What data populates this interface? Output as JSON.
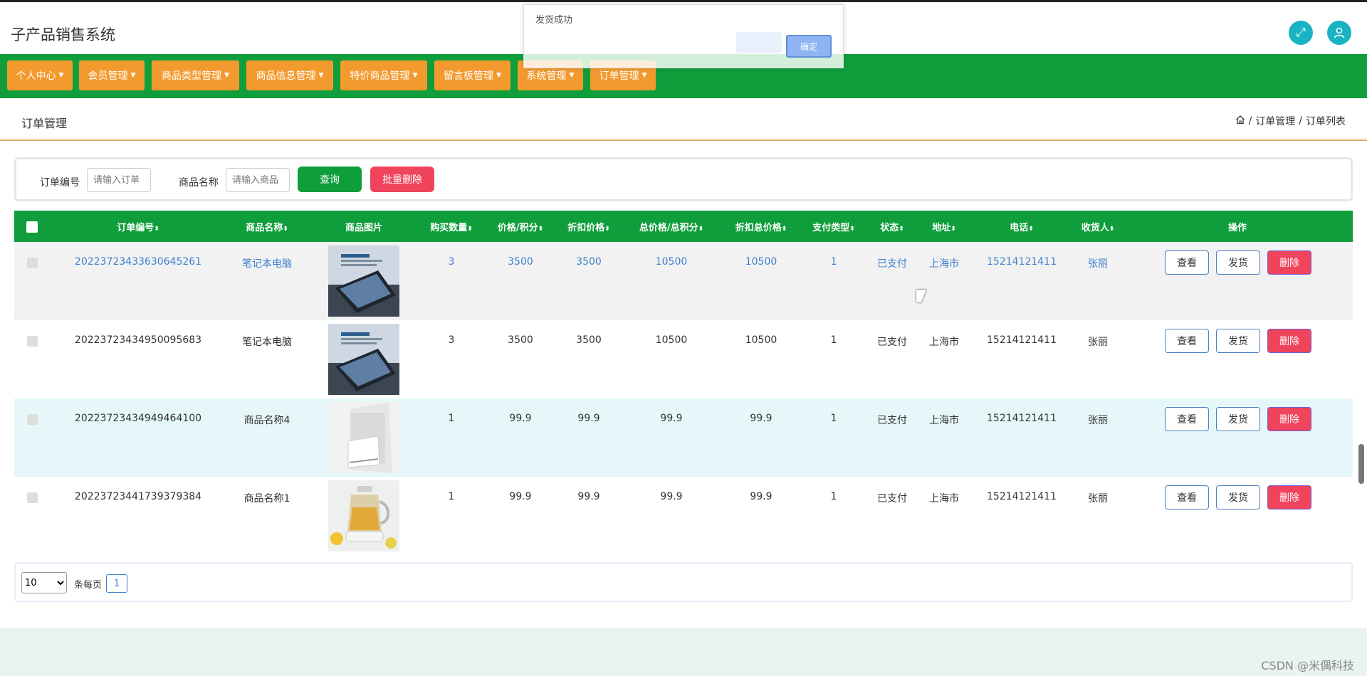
{
  "app": {
    "title": "子产品销售系统"
  },
  "header_icons": [
    "fullscreen-icon",
    "user-icon"
  ],
  "nav": {
    "items": [
      {
        "label": "个人中心"
      },
      {
        "label": "会员管理"
      },
      {
        "label": "商品类型管理"
      },
      {
        "label": "商品信息管理"
      },
      {
        "label": "特价商品管理"
      },
      {
        "label": "留言板管理"
      },
      {
        "label": "系统管理"
      },
      {
        "label": "订单管理"
      }
    ]
  },
  "breadcrumb": {
    "page_title": "订单管理",
    "trail": [
      "订单管理",
      "订单列表"
    ],
    "separator": "/"
  },
  "search": {
    "order_no_label": "订单编号",
    "order_no_placeholder": "请输入订单",
    "product_name_label": "商品名称",
    "product_name_placeholder": "请输入商品",
    "query_label": "查询",
    "batch_delete_label": "批量删除"
  },
  "table": {
    "columns": [
      "订单编号",
      "商品名称",
      "商品图片",
      "购买数量",
      "价格/积分",
      "折扣价格",
      "总价格/总积分",
      "折扣总价格",
      "支付类型",
      "状态",
      "地址",
      "电话",
      "收货人",
      "操作"
    ],
    "rows": [
      {
        "order_no": "20223723433630645261",
        "product": "笔记本电脑",
        "image": "laptop",
        "qty": "3",
        "price": "3500",
        "discount_price": "3500",
        "total": "10500",
        "discount_total": "10500",
        "pay_type": "1",
        "status": "已支付",
        "address": "上海市",
        "phone": "15214121411",
        "receiver": "张丽"
      },
      {
        "order_no": "20223723434950095683",
        "product": "笔记本电脑",
        "image": "laptop",
        "qty": "3",
        "price": "3500",
        "discount_price": "3500",
        "total": "10500",
        "discount_total": "10500",
        "pay_type": "1",
        "status": "已支付",
        "address": "上海市",
        "phone": "15214121411",
        "receiver": "张丽"
      },
      {
        "order_no": "20223723434949464100",
        "product": "商品名称4",
        "image": "air-conditioner",
        "qty": "1",
        "price": "99.9",
        "discount_price": "99.9",
        "total": "99.9",
        "discount_total": "99.9",
        "pay_type": "1",
        "status": "已支付",
        "address": "上海市",
        "phone": "15214121411",
        "receiver": "张丽"
      },
      {
        "order_no": "20223723441739379384",
        "product": "商品名称1",
        "image": "kettle",
        "qty": "1",
        "price": "99.9",
        "discount_price": "99.9",
        "total": "99.9",
        "discount_total": "99.9",
        "pay_type": "1",
        "status": "已支付",
        "address": "上海市",
        "phone": "15214121411",
        "receiver": "张丽"
      }
    ],
    "actions": {
      "view": "查看",
      "ship": "发货",
      "delete": "删除"
    }
  },
  "pagination": {
    "page_size": "10",
    "per_page_label": "条每页",
    "current_page": "1"
  },
  "dialog": {
    "message": "发货成功",
    "ok_label": "确定"
  },
  "watermark": "CSDN @米偶科技",
  "colors": {
    "primary_green": "#0f9e3b",
    "nav_orange": "#f39a2e",
    "danger": "#f0435c",
    "link_blue": "#3d7fce",
    "icon_teal": "#1ab3c4"
  }
}
